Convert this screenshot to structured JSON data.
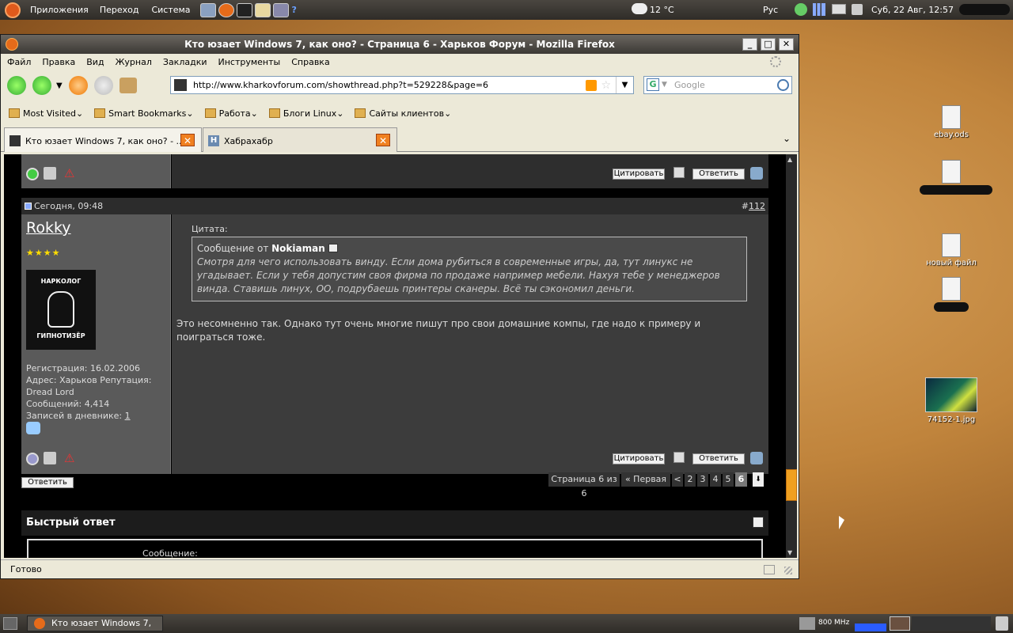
{
  "top_panel": {
    "menus": [
      "Приложения",
      "Переход",
      "Система"
    ],
    "weather": "12 °C",
    "keyboard_layout": "Рус",
    "datetime": "Суб, 22 Авг, 12:57"
  },
  "desktop": {
    "icons": [
      {
        "label": "ebay.ods"
      },
      {
        "label": "новый файл"
      },
      {
        "label": "74152-1.jpg"
      }
    ]
  },
  "window": {
    "title": "Кто юзает Windows 7, как оно? - Страница 6 - Харьков Форум - Mozilla Firefox",
    "menu": [
      "Файл",
      "Правка",
      "Вид",
      "Журнал",
      "Закладки",
      "Инструменты",
      "Справка"
    ],
    "url": "http://www.kharkovforum.com/showthread.php?t=529228&page=6",
    "search_placeholder": "Google",
    "bookmarks": [
      "Most Visited",
      "Smart Bookmarks",
      "Работа",
      "Блоги Linux",
      "Сайты клиентов"
    ],
    "tabs": [
      {
        "label": "Кто юзает Windows 7, как оно? - ..."
      },
      {
        "label": "Хабрахабр"
      }
    ],
    "status": "Готово"
  },
  "post": {
    "date": "Сегодня, 09:48",
    "number_prefix": "#",
    "number": "112",
    "author": "Rokky",
    "stars": "★★★★",
    "avatar_top": "НАРКОЛОГ",
    "avatar_bottom": "ГИПНОТИЗЁР",
    "registration": "Регистрация: 16.02.2006",
    "address": "Адрес: Харьков Репутация:",
    "reputation": "Dread Lord",
    "messages": "Сообщений: 4,414",
    "diary_label": "Записей в дневнике: ",
    "diary_count": "1",
    "quote_label": "Цитата:",
    "quote_from_prefix": "Сообщение от ",
    "quote_author": "Nokiaman",
    "quote_text": "Смотря для чего использовать винду. Если дома рубиться в современные игры, да, тут линукс не угадывает. Если у тебя допустим своя фирма по продаже например мебели. Нахуя тебе у менеджеров винда. Ставишь линух, ОО, подрубаешь принтеры сканеры. Всё ты сэкономил деньги.",
    "body": "Это несомненно так. Однако тут очень многие пишут про свои домашние компы, где надо к примеру и поиграться тоже.",
    "quote_button": "Цитировать",
    "reply_button": "Ответить"
  },
  "page_nav": {
    "reply_button": "Ответить",
    "page_info": "Страница 6 из 6",
    "first": "« Первая",
    "prev": "<",
    "pages": [
      "2",
      "3",
      "4",
      "5",
      "6"
    ]
  },
  "quick_reply": {
    "title": "Быстрый ответ",
    "message_label": "Сообщение:"
  },
  "bottom_panel": {
    "task": "Кто юзает Windows 7, ...",
    "cpu": "800 MHz"
  }
}
